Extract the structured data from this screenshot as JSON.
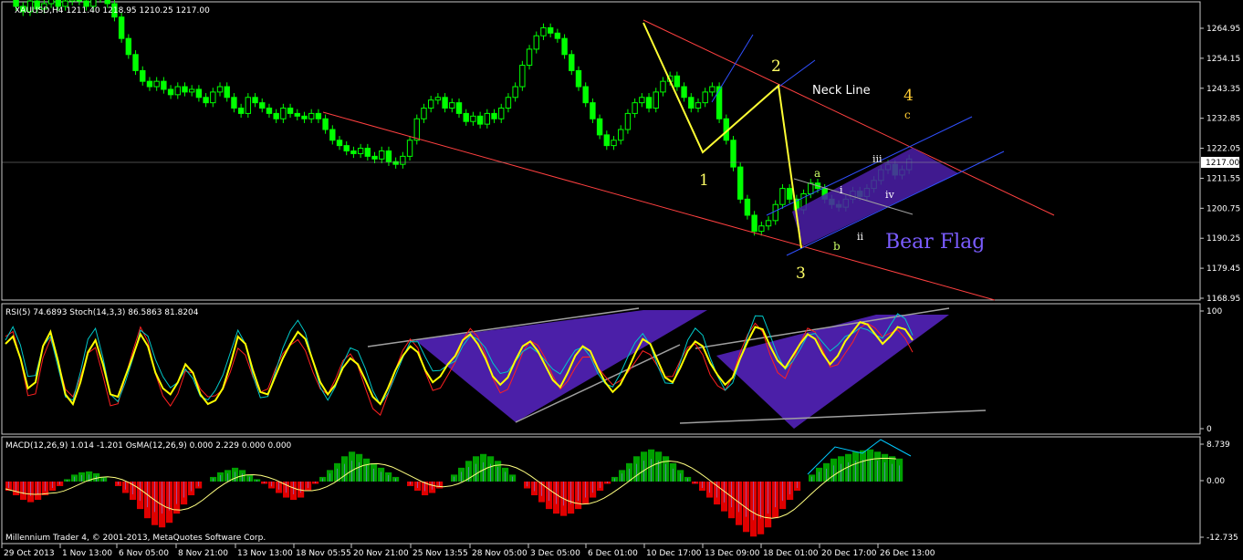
{
  "chart_data": [
    {
      "type": "candlestick",
      "panel": "price",
      "title": "XAUUSD,H4  1211.40 1218.95 1210.25 1217.00",
      "symbol": "XAUUSD",
      "timeframe": "H4",
      "ohlc": {
        "open": 1211.4,
        "high": 1218.95,
        "low": 1210.25,
        "close": 1217.0
      },
      "current_price_label": "1217.00",
      "ylim": [
        1165.0,
        1275.0
      ],
      "y_ticks": [
        "1264.95",
        "1254.15",
        "1243.35",
        "1232.85",
        "1222.05",
        "1211.55",
        "1200.75",
        "1190.25",
        "1179.45",
        "1168.95"
      ],
      "x_ticks": [
        "29 Oct 2013",
        "1 Nov 13:00",
        "6 Nov 05:00",
        "8 Nov 21:00",
        "13 Nov 13:00",
        "18 Nov 05:55",
        "20 Nov 21:00",
        "25 Nov 13:55",
        "28 Nov 05:00",
        "3 Dec 05:00",
        "6 Dec 01:00",
        "10 Dec 17:00",
        "13 Dec 09:00",
        "18 Dec 01:00",
        "20 Dec 17:00",
        "26 Dec 13:00"
      ],
      "close_series": [
        1278,
        1274,
        1272,
        1276,
        1273,
        1275,
        1277,
        1274,
        1276,
        1278,
        1276,
        1274,
        1279,
        1277,
        1275,
        1270,
        1262,
        1256,
        1250,
        1246,
        1244,
        1246,
        1243,
        1241,
        1244,
        1242,
        1243,
        1240,
        1238,
        1242,
        1244,
        1240,
        1236,
        1234,
        1240,
        1238,
        1236,
        1234,
        1232,
        1236,
        1234,
        1233,
        1232,
        1234,
        1232,
        1228,
        1224,
        1222,
        1220,
        1219,
        1221,
        1218,
        1217,
        1220,
        1216,
        1215,
        1218,
        1224,
        1232,
        1236,
        1239,
        1240,
        1236,
        1238,
        1234,
        1231,
        1233,
        1230,
        1234,
        1232,
        1236,
        1240,
        1244,
        1252,
        1258,
        1263,
        1266,
        1264,
        1262,
        1256,
        1250,
        1244,
        1238,
        1232,
        1226,
        1222,
        1224,
        1228,
        1234,
        1238,
        1240,
        1236,
        1242,
        1246,
        1248,
        1244,
        1240,
        1236,
        1238,
        1242,
        1244,
        1232,
        1224,
        1214,
        1202,
        1196,
        1190,
        1192,
        1194,
        1200,
        1206,
        1202,
        1198,
        1204,
        1208,
        1206,
        1202,
        1200,
        1199,
        1202,
        1205,
        1203,
        1206,
        1209,
        1213,
        1215,
        1211,
        1213,
        1217
      ],
      "annotations": {
        "wave_labels": [
          "1",
          "2",
          "3",
          "4"
        ],
        "subwave_labels": [
          "a",
          "b",
          "c",
          "i",
          "ii",
          "iii",
          "iv"
        ],
        "text": [
          "Neck Line",
          "Bear Flag"
        ]
      }
    },
    {
      "type": "line",
      "panel": "oscillator",
      "title": "RSI(5) 74.6893  Stoch(14,3,3) 86.5863 81.8204",
      "ylim": [
        0,
        100
      ],
      "y_ticks": [
        "100",
        "0"
      ],
      "series": [
        {
          "name": "RSI(5)",
          "last": 74.6893,
          "color": "#ffff00"
        },
        {
          "name": "Stoch(14,3,3) %K",
          "last": 86.5863,
          "color": "#00c8c8"
        },
        {
          "name": "Stoch(14,3,3) %D",
          "last": 81.8204,
          "color": "#ff2020"
        }
      ],
      "rsi_series": [
        72,
        78,
        60,
        35,
        40,
        70,
        82,
        58,
        30,
        22,
        40,
        65,
        75,
        55,
        30,
        28,
        45,
        62,
        80,
        70,
        48,
        35,
        30,
        40,
        55,
        48,
        30,
        22,
        25,
        35,
        55,
        78,
        72,
        50,
        32,
        30,
        45,
        60,
        72,
        82,
        76,
        58,
        40,
        30,
        38,
        52,
        60,
        55,
        42,
        28,
        22,
        35,
        50,
        62,
        70,
        65,
        50,
        40,
        45,
        55,
        62,
        75,
        80,
        72,
        60,
        45,
        38,
        44,
        58,
        70,
        74,
        66,
        54,
        42,
        36,
        48,
        62,
        70,
        66,
        52,
        40,
        32,
        38,
        50,
        64,
        76,
        72,
        58,
        44,
        40,
        52,
        66,
        74,
        70,
        56,
        46,
        38,
        44,
        60,
        74,
        86,
        84,
        70,
        58,
        52,
        62,
        72,
        80,
        76,
        64,
        55,
        62,
        74,
        82,
        90,
        88,
        80,
        72,
        78,
        86,
        84,
        75
      ]
    },
    {
      "type": "bar",
      "panel": "macd",
      "title": "MACD(12,26,9) 1.014 -1.201  OsMA(12,26,9) 0.000 2.229 0.000 0.000",
      "ylim": [
        -12.735,
        8.739
      ],
      "y_ticks": [
        "8.739",
        "0.00",
        "-12.735"
      ],
      "osma_values": [
        -2,
        -3,
        -4,
        -4.5,
        -4,
        -3,
        -2,
        -1,
        0.5,
        1.5,
        2,
        2.2,
        1.8,
        1,
        0,
        -1,
        -2.5,
        -4,
        -6,
        -8,
        -9.5,
        -10,
        -9,
        -7,
        -5,
        -3,
        -1.5,
        0,
        1,
        2,
        2.5,
        3,
        2.5,
        1.5,
        0.5,
        -0.5,
        -1.5,
        -2.5,
        -3.5,
        -4,
        -3.5,
        -2,
        -0.5,
        1,
        2.5,
        4,
        5.5,
        6.5,
        6,
        5,
        4,
        3,
        2,
        1,
        0,
        -1,
        -2,
        -3,
        -2.5,
        -1.5,
        0,
        1.5,
        3,
        4.5,
        5.5,
        6,
        5.5,
        4.5,
        3,
        1.5,
        0,
        -1.5,
        -3,
        -4.5,
        -6,
        -7,
        -7.5,
        -7,
        -6,
        -5,
        -3.5,
        -2,
        -0.5,
        1,
        2.5,
        4,
        5.5,
        6.5,
        7,
        6.5,
        5.5,
        4,
        2.5,
        1,
        -0.5,
        -2,
        -3.5,
        -5,
        -6.5,
        -8,
        -9.5,
        -11,
        -12,
        -11.5,
        -10,
        -8,
        -6,
        -4,
        -2,
        0,
        1.5,
        3,
        4,
        5,
        5.5,
        6,
        6.5,
        6.8,
        7,
        6.5,
        6,
        5.5,
        5
      ],
      "macd_signal_color": "#ffff80",
      "histogram_up_color": "#00a000",
      "histogram_down_color": "#e00000"
    }
  ],
  "footer_text": "Millennium Trader 4, © 2001-2013, MetaQuotes Software Corp."
}
